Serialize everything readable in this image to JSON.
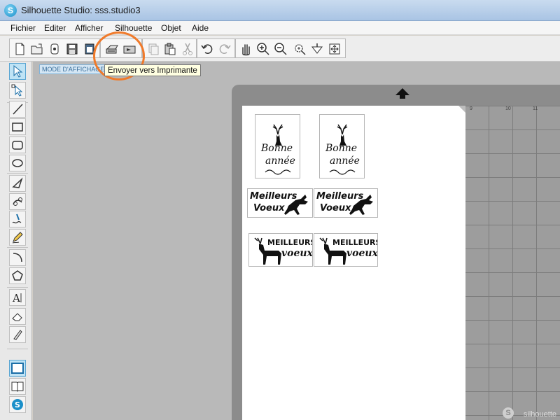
{
  "window": {
    "title": "Silhouette Studio: sss.studio3",
    "app_icon_letter": "S"
  },
  "menu": {
    "items": [
      "Fichier",
      "Editer",
      "Afficher",
      "Silhouette",
      "Objet",
      "Aide"
    ]
  },
  "toolbar": {
    "buttons": [
      {
        "name": "new-document",
        "icon": "page-icon"
      },
      {
        "name": "open",
        "icon": "folder-open-icon"
      },
      {
        "name": "library",
        "icon": "library-icon"
      },
      {
        "name": "save",
        "icon": "floppy-icon"
      },
      {
        "name": "store",
        "icon": "store-icon"
      },
      {
        "name": "print",
        "icon": "printer-icon"
      },
      {
        "name": "send-to-printer",
        "icon": "send-printer-icon"
      },
      {
        "name": "copy",
        "icon": "copy-icon"
      },
      {
        "name": "paste",
        "icon": "paste-icon"
      },
      {
        "name": "cut",
        "icon": "scissors-icon"
      },
      {
        "name": "undo",
        "icon": "undo-icon"
      },
      {
        "name": "redo",
        "icon": "redo-icon"
      },
      {
        "name": "pan",
        "icon": "hand-icon"
      },
      {
        "name": "zoom-in",
        "icon": "zoom-in-icon"
      },
      {
        "name": "zoom-out",
        "icon": "zoom-out-icon"
      },
      {
        "name": "zoom-selection",
        "icon": "zoom-select-icon"
      },
      {
        "name": "drag-zoom",
        "icon": "drag-zoom-icon"
      },
      {
        "name": "fit-to-page",
        "icon": "fit-page-icon"
      }
    ]
  },
  "tooltip": "Envoyer vers Imprimante",
  "mode_tab": "MODE D'AFFICHAGE",
  "tools": [
    {
      "name": "select",
      "icon": "pointer-icon"
    },
    {
      "name": "edit-points",
      "icon": "point-edit-icon"
    },
    {
      "name": "line",
      "icon": "line-icon"
    },
    {
      "name": "rectangle",
      "icon": "rectangle-icon"
    },
    {
      "name": "rounded-rectangle",
      "icon": "rounded-rect-icon"
    },
    {
      "name": "ellipse",
      "icon": "ellipse-icon"
    },
    {
      "name": "polygon",
      "icon": "polygon-icon"
    },
    {
      "name": "curve",
      "icon": "curve-icon"
    },
    {
      "name": "freehand",
      "icon": "freehand-icon"
    },
    {
      "name": "smooth-freehand",
      "icon": "pencil-icon"
    },
    {
      "name": "arc",
      "icon": "arc-icon"
    },
    {
      "name": "regular-polygon",
      "icon": "pentagon-icon"
    },
    {
      "name": "text",
      "icon": "text-icon"
    },
    {
      "name": "eraser",
      "icon": "eraser-icon"
    },
    {
      "name": "knife",
      "icon": "knife-icon"
    },
    {
      "name": "design-view",
      "icon": "design-view-icon"
    },
    {
      "name": "library-view",
      "icon": "book-icon"
    },
    {
      "name": "store-view",
      "icon": "silhouette-logo-icon"
    }
  ],
  "mat": {
    "ruler_numbers": [
      "9",
      "10",
      "11"
    ]
  },
  "cards": [
    {
      "line1": "Bonne",
      "line2": "année"
    },
    {
      "line1": "Bonne",
      "line2": "année"
    },
    {
      "line1": "Meilleurs",
      "line2": "Voeux"
    },
    {
      "line1": "Meilleurs",
      "line2": "Voeux"
    },
    {
      "line1": "MEILLEURS",
      "line2": "voeux"
    },
    {
      "line1": "MEILLEURS",
      "line2": "voeux"
    }
  ],
  "brand": {
    "text": "silhouette",
    "logo_letter": "S"
  },
  "colors": {
    "highlight": "#f07a2a",
    "active_tool": "#bfe3f5"
  }
}
